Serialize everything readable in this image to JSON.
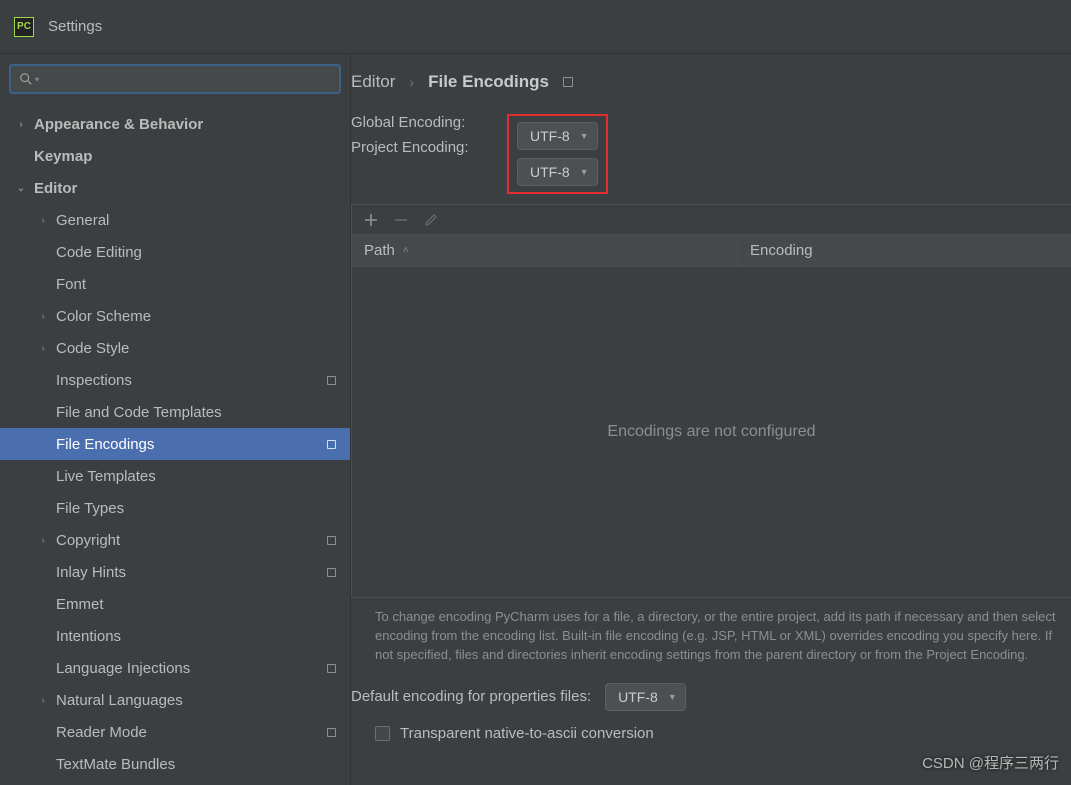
{
  "title": "Settings",
  "search": {
    "placeholder": ""
  },
  "sidebar": {
    "items": [
      {
        "label": "Appearance & Behavior",
        "level": 0,
        "arrow": "right",
        "modified": false
      },
      {
        "label": "Keymap",
        "level": 0,
        "arrow": "none",
        "modified": false
      },
      {
        "label": "Editor",
        "level": 0,
        "arrow": "down",
        "modified": false
      },
      {
        "label": "General",
        "level": 1,
        "arrow": "right",
        "modified": false
      },
      {
        "label": "Code Editing",
        "level": 1,
        "arrow": "none",
        "modified": false
      },
      {
        "label": "Font",
        "level": 1,
        "arrow": "none",
        "modified": false
      },
      {
        "label": "Color Scheme",
        "level": 1,
        "arrow": "right",
        "modified": false
      },
      {
        "label": "Code Style",
        "level": 1,
        "arrow": "right",
        "modified": false
      },
      {
        "label": "Inspections",
        "level": 1,
        "arrow": "none",
        "modified": true
      },
      {
        "label": "File and Code Templates",
        "level": 1,
        "arrow": "none",
        "modified": false
      },
      {
        "label": "File Encodings",
        "level": 1,
        "arrow": "none",
        "modified": true,
        "selected": true
      },
      {
        "label": "Live Templates",
        "level": 1,
        "arrow": "none",
        "modified": false
      },
      {
        "label": "File Types",
        "level": 1,
        "arrow": "none",
        "modified": false
      },
      {
        "label": "Copyright",
        "level": 1,
        "arrow": "right",
        "modified": true
      },
      {
        "label": "Inlay Hints",
        "level": 1,
        "arrow": "none",
        "modified": true
      },
      {
        "label": "Emmet",
        "level": 1,
        "arrow": "none",
        "modified": false
      },
      {
        "label": "Intentions",
        "level": 1,
        "arrow": "none",
        "modified": false
      },
      {
        "label": "Language Injections",
        "level": 1,
        "arrow": "none",
        "modified": true
      },
      {
        "label": "Natural Languages",
        "level": 1,
        "arrow": "right",
        "modified": false
      },
      {
        "label": "Reader Mode",
        "level": 1,
        "arrow": "none",
        "modified": true
      },
      {
        "label": "TextMate Bundles",
        "level": 1,
        "arrow": "none",
        "modified": false
      }
    ]
  },
  "breadcrumb": {
    "root": "Editor",
    "current": "File Encodings"
  },
  "encodings": {
    "global_label": "Global Encoding:",
    "global_value": "UTF-8",
    "project_label": "Project Encoding:",
    "project_value": "UTF-8"
  },
  "table": {
    "col_path": "Path",
    "col_encoding": "Encoding",
    "empty_text": "Encodings are not configured"
  },
  "help_text": "To change encoding PyCharm uses for a file, a directory, or the entire project, add its path if necessary and then select encoding from the encoding list. Built-in file encoding (e.g. JSP, HTML or XML) overrides encoding you specify here. If not specified, files and directories inherit encoding settings from the parent directory or from the Project Encoding.",
  "prop_files": {
    "label": "Default encoding for properties files:",
    "value": "UTF-8"
  },
  "transparent_label": "Transparent native-to-ascii conversion",
  "watermark": "CSDN @程序三两行",
  "logo_text": "PC"
}
